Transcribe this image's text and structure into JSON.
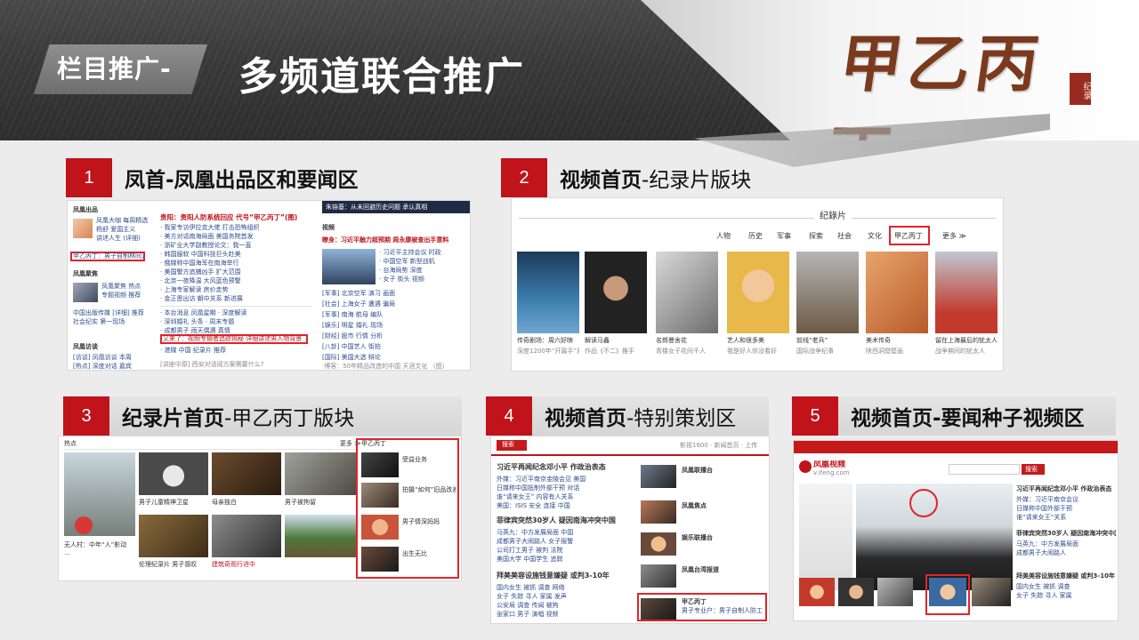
{
  "header": {
    "tag": "栏目推广-",
    "title": "多频道联合推广",
    "logo_text": "甲乙丙丁",
    "logo_seal": "纪录"
  },
  "sections": [
    {
      "num": "1",
      "bold": "凤首-凤凰出品区和要闻区",
      "rest": ""
    },
    {
      "num": "2",
      "bold": "视频首页",
      "rest": "-纪录片版块"
    },
    {
      "num": "3",
      "bold": "纪录片首页",
      "rest": "-甲乙丙丁版块"
    },
    {
      "num": "4",
      "bold": "视频首页",
      "rest": "-特别策划区"
    },
    {
      "num": "5",
      "bold": "视频首页-要闻种子视频区",
      "rest": ""
    }
  ],
  "panel1": {
    "left_heading": "凤凰出品",
    "left_heading2": "凤凰聚焦",
    "left_heading3": "凤凰访谈",
    "highlight_left": "甲乙丙丁：男子自制林间人防",
    "headline": "贵阳：贵阳人防系统回应 代号“甲乙丙丁”(图)",
    "banner_text": "朱镕基：从未回避历史问题 承认真相",
    "col_heading": "视频",
    "highlight_mid": "又来了：视频专辑者追踪揭秘 详细讲述男人物背景",
    "right_headline": "瞭身：习近平触力超预期 周永康被查出手意料",
    "footer": "[讲座中原] 西安对话阅方案需要什么?",
    "footer_right": "·博客：50年精品改造的中国 天涯文化 （图）"
  },
  "panel2": {
    "section_title": "纪錄片",
    "tabs": [
      "人物",
      "历史",
      "军事",
      "探索",
      "社会",
      "文化",
      "甲乙丙丁",
      "更多 ≫"
    ],
    "captions": [
      "传奇剧场：周六好映",
      "解读马鑫",
      "名郎曼舍花",
      "艺人和很多美",
      "前线“老兵”",
      "美术传奇",
      "留在上海最后的犹太人"
    ],
    "subcaptions": [
      "深度1200年“开篇手”周六",
      "作品《不二》推手",
      "青楼女子花间千人",
      "我是好人你没看好",
      "国际战争纪事",
      "陕西洞窟壁画",
      "战争期间的犹太人"
    ]
  },
  "panel3": {
    "heading": "热点",
    "right_heading": "甲乙丙丁",
    "more": "更多 ≫",
    "captions": [
      "无人村：中年“人”影动",
      "男子儿童精神卫星",
      "母亲独白",
      "",
      "",
      "男子被拘留",
      "",
      "伦理纪录片 男子感叹",
      "",
      "建筑奇观行进中"
    ],
    "right_items": [
      "受益业务",
      "拍摄“如何”旧品改善?",
      "男子情深妈妈",
      "出生无比"
    ]
  },
  "panel4": {
    "search": "搜索",
    "top_right": "影视1600 · 新闻首页 · 上传",
    "headlines": [
      "习近平再闻纪念邓小平 作政治表态",
      "菲律宾突然30岁人 疑因南海冲突中国",
      "拜美美容设施钱意嫌疑 或判3-10年"
    ],
    "right_items": [
      "凤凰联播台",
      "凤凰焦点",
      "娱乐联播台",
      "凤凰台湾报道",
      "甲乙丙丁"
    ],
    "right_caption": "男子专业户：男子自制人防工"
  },
  "panel5": {
    "logo": "凤凰视频",
    "logo_url": "v.ifeng.com",
    "search": "搜索",
    "headlines": [
      "习近平再闻纪念邓小平 作政治表态",
      "菲律宾突然30岁人 疑因南海冲突中国",
      "拜美美容设施钱意嫌疑 或判3-10年"
    ]
  },
  "colors": {
    "accent_red": "#c0131a",
    "link_blue": "#2b4d8c",
    "header_dark": "#3a3a3a"
  }
}
